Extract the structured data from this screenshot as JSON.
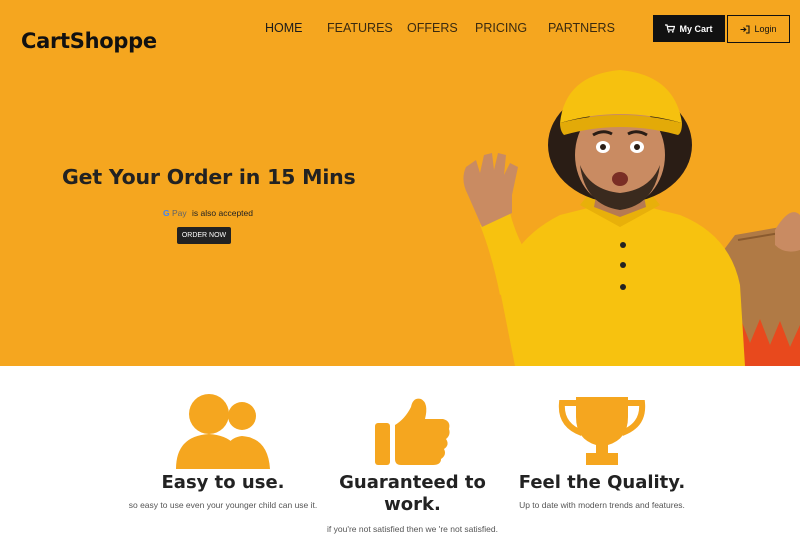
{
  "brand": "CartShoppe",
  "nav": {
    "items": [
      {
        "label": "HOME",
        "active": true
      },
      {
        "label": "FEATURES",
        "active": false
      },
      {
        "label": "OFFERS",
        "active": false
      },
      {
        "label": "PRICING",
        "active": false
      },
      {
        "label": "PARTNERS",
        "active": false
      }
    ]
  },
  "actions": {
    "cart_label": "My Cart",
    "login_label": "Login",
    "cart_icon": "cart-icon",
    "login_icon": "sign-in-icon"
  },
  "hero": {
    "headline": "Get Your Order in 15 Mins",
    "gpay_logo_g": "G",
    "gpay_logo_pay": "Pay",
    "gpay_text": "is also accepted",
    "order_button": "ORDER NOW",
    "background_color": "#f5a61f"
  },
  "features": [
    {
      "icon": "users-icon",
      "title": "Easy to use.",
      "description": "so easy to use even your younger child can use it."
    },
    {
      "icon": "thumbs-up-icon",
      "title": "Guaranteed to work.",
      "description": "if you're not satisfied then we 're not satisfied."
    },
    {
      "icon": "trophy-icon",
      "title": "Feel the Quality.",
      "description": "Up to date with modern trends and features."
    }
  ],
  "accent_color": "#f5a61f"
}
